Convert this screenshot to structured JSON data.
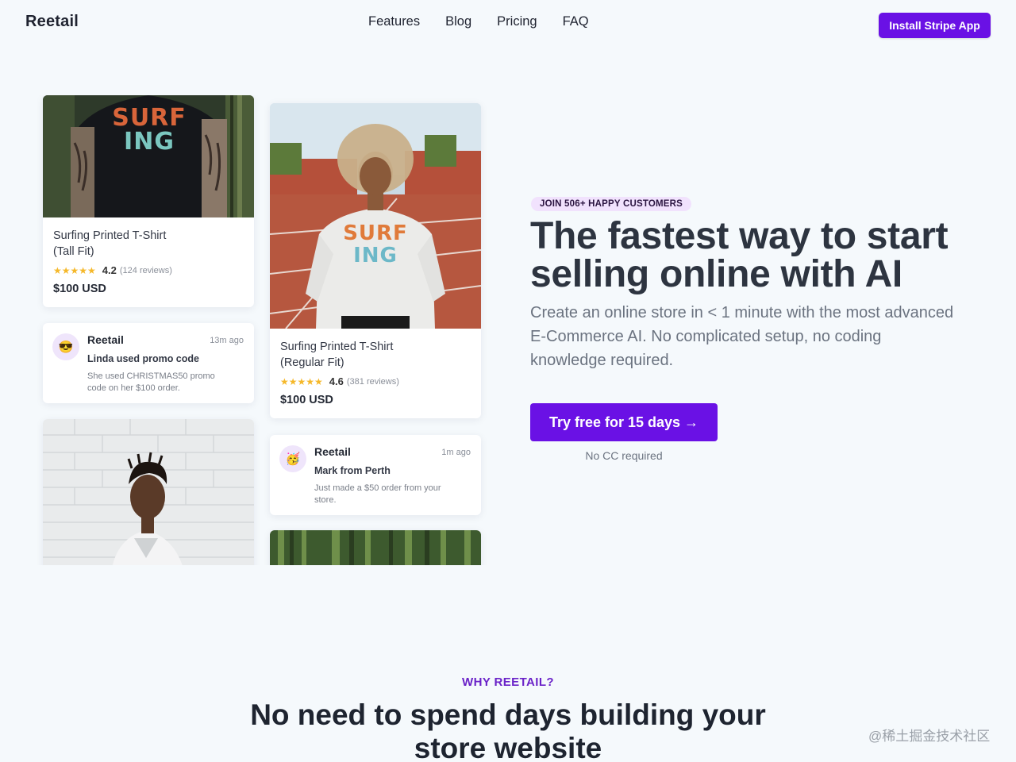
{
  "nav": {
    "logo": "Reetail",
    "links": [
      "Features",
      "Blog",
      "Pricing",
      "FAQ"
    ],
    "install_label": "Install Stripe App"
  },
  "products": [
    {
      "title_line1": "Surfing Printed T-Shirt",
      "title_line2": "(Tall Fit)",
      "stars": "★★★★★",
      "score": "4.2",
      "reviews": "(124 reviews)",
      "price": "$100 USD",
      "shirt_text1": "SURF",
      "shirt_text2": "ING"
    },
    {
      "title_line1": "Surfing Printed T-Shirt",
      "title_line2": "(Regular Fit)",
      "stars": "★★★★★",
      "score": "4.6",
      "reviews": "(381 reviews)",
      "price": "$100 USD",
      "shirt_text1": "SURF",
      "shirt_text2": "ING"
    }
  ],
  "notifications": [
    {
      "avatar": "😎",
      "name": "Reetail",
      "time": "13m ago",
      "title": "Linda used promo code",
      "desc": "She used CHRISTMAS50 promo code on her $100 order."
    },
    {
      "avatar": "🥳",
      "name": "Reetail",
      "time": "1m ago",
      "title": "Mark from Perth",
      "desc": "Just made a $50 order from your store."
    }
  ],
  "hero": {
    "badge": "JOIN 506+ HAPPY CUSTOMERS",
    "title": "The fastest way to start selling online with AI",
    "subtitle": "Create an online store in < 1 minute with the most advanced E-Commerce AI. No complicated setup, no coding knowledge required.",
    "cta_label": "Try free for 15 days →",
    "cta_note": "No CC required"
  },
  "why": {
    "eyebrow": "WHY REETAIL?",
    "title": "No need to spend days building your store website"
  },
  "watermark": "@稀土掘金技术社区",
  "colors": {
    "accent": "#6a11e5",
    "badge_bg": "#f1e2fd",
    "page_bg": "#f5f9fc"
  }
}
